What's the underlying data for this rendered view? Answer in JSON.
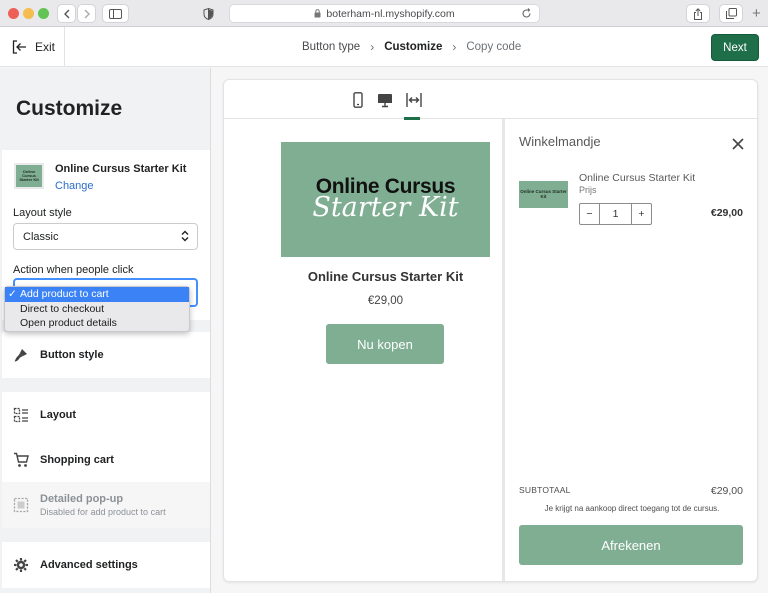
{
  "browser": {
    "url": "boterham-nl.myshopify.com"
  },
  "appbar": {
    "exit_label": "Exit",
    "steps": [
      "Button type",
      "Customize",
      "Copy code"
    ],
    "next_label": "Next"
  },
  "sidebar": {
    "title": "Customize",
    "product": {
      "name": "Online Cursus Starter Kit",
      "change_label": "Change",
      "thumb_text": "Online Cursus Starter Kit"
    },
    "layout_style": {
      "label": "Layout style",
      "value": "Classic"
    },
    "action": {
      "label": "Action when people click",
      "options": [
        "Add product to cart",
        "Direct to checkout",
        "Open product details"
      ],
      "selected_index": 0
    },
    "menu": {
      "button_style": "Button style",
      "layout": "Layout",
      "shopping_cart": "Shopping cart",
      "detailed_popup": "Detailed pop-up",
      "detailed_popup_sub": "Disabled for add product to cart",
      "advanced_settings": "Advanced settings"
    }
  },
  "preview": {
    "product": {
      "banner_line1": "Online Cursus",
      "banner_line2": "Starter Kit",
      "title": "Online Cursus Starter Kit",
      "price": "€29,00",
      "buy_label": "Nu kopen"
    },
    "cart": {
      "title": "Winkelmandje",
      "item_name": "Online Cursus Starter Kit",
      "item_variant": "Prijs",
      "thumb_text": "Online Cursus Starter Kit",
      "quantity": "1",
      "minus": "−",
      "plus": "+",
      "item_price": "€29,00",
      "subtotal_label": "SUBTOTAAL",
      "subtotal_value": "€29,00",
      "note": "Je krijgt na aankoop direct toegang tot de cursus.",
      "checkout_label": "Afrekenen"
    }
  },
  "colors": {
    "brand_green": "#1e6e4a",
    "product_green": "#7fae93",
    "link_blue": "#2c6ecb",
    "select_highlight": "#3a82f6"
  }
}
